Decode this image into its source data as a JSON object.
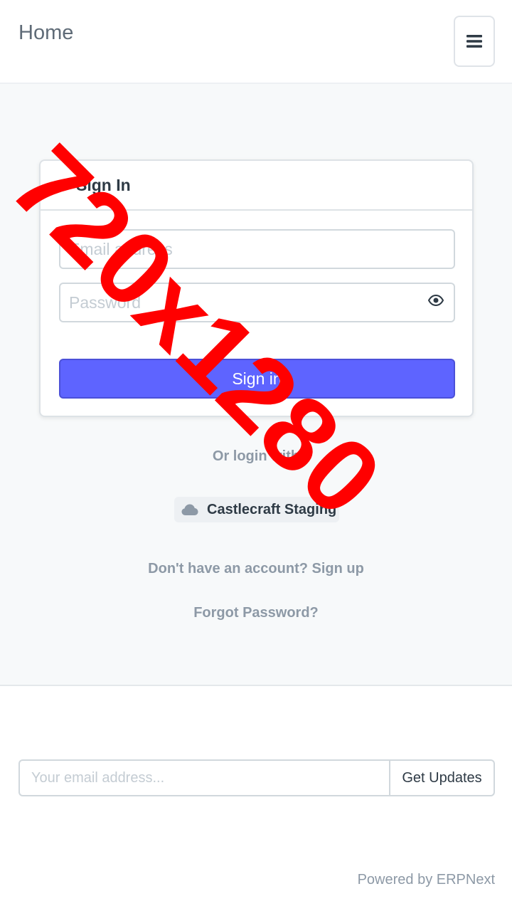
{
  "navbar": {
    "brand": "Home",
    "menu_icon": "hamburger-menu-icon"
  },
  "login": {
    "title": "Sign In",
    "accent_color": "#5e64ff",
    "email_placeholder": "Email address",
    "email_value": "",
    "password_placeholder": "Password",
    "password_value": "",
    "password_toggle_icon": "eye-icon",
    "submit_label": "Sign in",
    "or_login_with": "Or login with",
    "provider": {
      "icon": "cloud-icon",
      "label": "Castlecraft Staging"
    },
    "signup_text": "Don't have an account? Sign up",
    "forgot_text": "Forgot Password?"
  },
  "footer": {
    "subscribe_placeholder": "Your email address...",
    "subscribe_value": "",
    "subscribe_button": "Get Updates",
    "powered_by": "Powered by ERPNext"
  },
  "watermark": {
    "text": "720x1280",
    "color": "#ff0000"
  }
}
